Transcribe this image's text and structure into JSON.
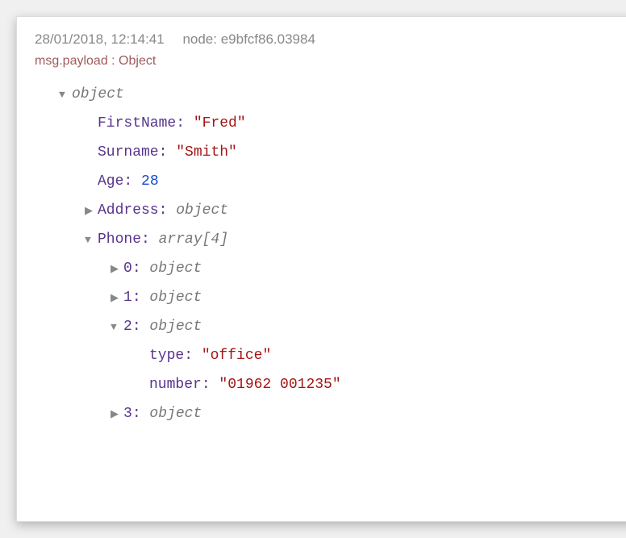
{
  "header": {
    "timestamp": "28/01/2018, 12:14:41",
    "node_label": "node: e9bfcf86.03984"
  },
  "payload_label": "msg.payload : Object",
  "root": {
    "type_label": "object",
    "FirstName": {
      "key": "FirstName",
      "value": "\"Fred\""
    },
    "Surname": {
      "key": "Surname",
      "value": "\"Smith\""
    },
    "Age": {
      "key": "Age",
      "value": "28"
    },
    "Address": {
      "key": "Address",
      "type_label": "object"
    },
    "Phone": {
      "key": "Phone",
      "type_label": "array[4]",
      "items": [
        {
          "key": "0",
          "type_label": "object"
        },
        {
          "key": "1",
          "type_label": "object"
        },
        {
          "key": "2",
          "type_label": "object",
          "type": {
            "key": "type",
            "value": "\"office\""
          },
          "number": {
            "key": "number",
            "value": "\"01962 001235\""
          }
        },
        {
          "key": "3",
          "type_label": "object"
        }
      ]
    }
  }
}
